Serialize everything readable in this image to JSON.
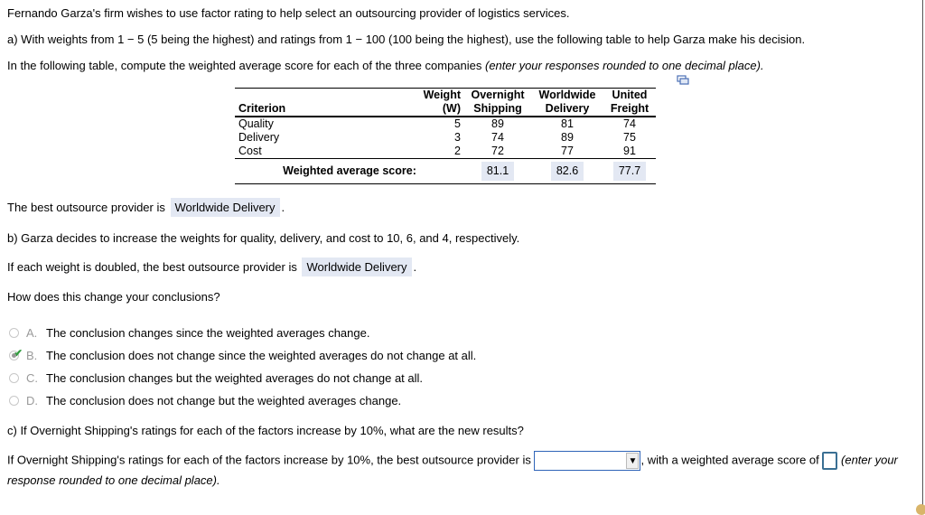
{
  "intro": "Fernando Garza's firm wishes to use factor rating to help select an outsourcing provider of logistics services.",
  "part_a": {
    "prompt": "a) With weights from 1 − 5 (5 being the highest) and ratings from 1 − 100 (100 being the highest), use the following table to help Garza make his decision.",
    "instruction": "In the following table, compute the weighted average score for each of the three companies ",
    "instruction_italic": "(enter your responses rounded to one decimal place).",
    "copy_icon": "copy-table-icon",
    "table": {
      "headers": {
        "criterion": "Criterion",
        "weight": [
          "Weight",
          "(W)"
        ],
        "overnight": [
          "Overnight",
          "Shipping"
        ],
        "worldwide": [
          "Worldwide",
          "Delivery"
        ],
        "united": [
          "United",
          "Freight"
        ]
      },
      "rows": [
        {
          "criterion": "Quality",
          "weight": "5",
          "overnight": "89",
          "worldwide": "81",
          "united": "74"
        },
        {
          "criterion": "Delivery",
          "weight": "3",
          "overnight": "74",
          "worldwide": "89",
          "united": "75"
        },
        {
          "criterion": "Cost",
          "weight": "2",
          "overnight": "72",
          "worldwide": "77",
          "united": "91"
        }
      ],
      "footer_label": "Weighted average score:",
      "scores": {
        "overnight": "81.1",
        "worldwide": "82.6",
        "united": "77.7"
      }
    },
    "best_prefix": "The best outsource provider is",
    "best_answer": "Worldwide Delivery",
    "best_suffix": "."
  },
  "part_b": {
    "prompt": "b) Garza decides to increase the weights for quality, delivery, and cost to 10, 6, and 4, respectively.",
    "doubled_prefix": "If each weight is doubled, the best outsource provider is",
    "doubled_answer": "Worldwide Delivery",
    "doubled_suffix": ".",
    "question": "How does this change your conclusions?",
    "options": [
      {
        "letter": "A.",
        "text": "The conclusion changes since the weighted averages change.",
        "selected": false
      },
      {
        "letter": "B.",
        "text": "The conclusion does not change since the weighted averages do not change at all.",
        "selected": true,
        "correct_mark": "✔"
      },
      {
        "letter": "C.",
        "text": "The conclusion changes but the weighted averages do not change at all.",
        "selected": false
      },
      {
        "letter": "D.",
        "text": "The conclusion does not change but the weighted averages change.",
        "selected": false
      }
    ]
  },
  "part_c": {
    "prompt": "c) If Overnight Shipping's ratings for each of the factors increase by 10%, what are the new results?",
    "sentence_prefix": "If Overnight Shipping's ratings for each of the factors increase by 10%, the best outsource provider is",
    "select_value": "",
    "select_arrow": "▼",
    "sentence_middle": ", with a weighted average score of",
    "score_value": "",
    "hint_part1": "(enter your",
    "hint_part2": "response rounded to one decimal place)."
  }
}
